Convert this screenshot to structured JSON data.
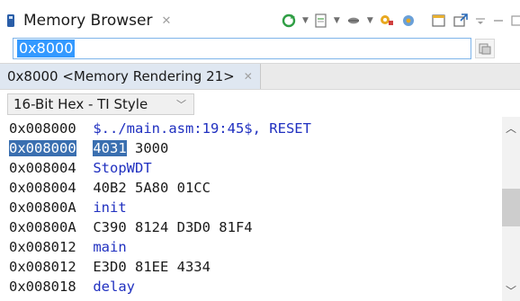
{
  "view": {
    "title": "Memory Browser",
    "close_glyph": "✕"
  },
  "toolbar": {
    "icons": [
      "refresh-icon",
      "new-rendering-icon",
      "link-icon",
      "filter-icon",
      "pin-icon",
      "new-view-icon",
      "minimize-icon",
      "maximize-icon"
    ]
  },
  "address": {
    "value": "0x8000"
  },
  "rendering_tab": {
    "label": "0x8000 <Memory Rendering 21>",
    "close_glyph": "✕"
  },
  "format": {
    "selected": "16-Bit Hex - TI Style"
  },
  "memory_lines": [
    {
      "addr": "0x008000",
      "text": "$../main.asm:19:45$, RESET",
      "kind": "label"
    },
    {
      "addr": "0x008000",
      "text": "4031 3000",
      "kind": "hex",
      "selected_prefix": "4031",
      "rest": " 3000"
    },
    {
      "addr": "0x008004",
      "text": "StopWDT",
      "kind": "label"
    },
    {
      "addr": "0x008004",
      "text": "40B2 5A80 01CC",
      "kind": "hex"
    },
    {
      "addr": "0x00800A",
      "text": "init",
      "kind": "label"
    },
    {
      "addr": "0x00800A",
      "text": "C390 8124 D3D0 81F4",
      "kind": "hex"
    },
    {
      "addr": "0x008012",
      "text": "main",
      "kind": "label"
    },
    {
      "addr": "0x008012",
      "text": "E3D0 81EE 4334",
      "kind": "hex"
    },
    {
      "addr": "0x008018",
      "text": "delay",
      "kind": "label"
    }
  ],
  "colors": {
    "label": "#2030c0",
    "selection": "#3a6fb0",
    "input_border": "#7eb4ea"
  }
}
